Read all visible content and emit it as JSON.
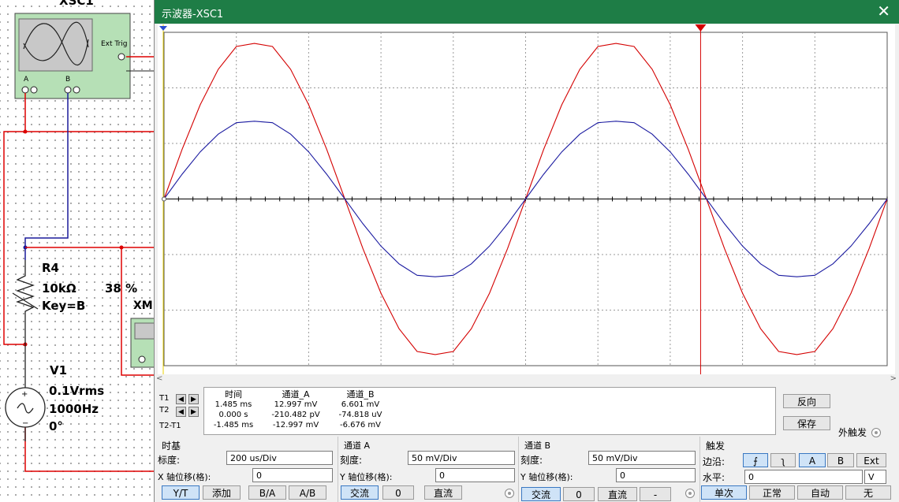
{
  "schematic": {
    "scope_ref": "XSC1",
    "ext_trig": "Ext Trig",
    "ch_a": "A",
    "ch_b": "B",
    "r_name": "R4",
    "r_value": "10kΩ",
    "r_percent": "38 %",
    "r_key": "Key=B",
    "xm_label": "XM",
    "v_name": "V1",
    "v_amp": "0.1Vrms",
    "v_freq": "1000Hz",
    "v_phase": "0°",
    "colors": {
      "wire_red": "#dd0000",
      "wire_blue": "#1a1a9a"
    }
  },
  "window": {
    "title": "示波器-XSC1",
    "close_label": "✕",
    "titlebar_color": "#1e7d46"
  },
  "chart_data": {
    "type": "line",
    "x_divisions": 10,
    "y_divisions": 6,
    "timebase": "200 us/Div",
    "cursor_t1_fraction": 0.742,
    "series": [
      {
        "channel": "A",
        "color": "#d40000",
        "scale": "50 mV/Div",
        "peak_mV": 13.0
      },
      {
        "channel": "B",
        "color": "#1a1aa0",
        "scale": "50 mV/Div",
        "peak_mV": 6.6
      }
    ],
    "frequency_hz": 1000,
    "x_range_us": [
      0,
      2000
    ]
  },
  "readout": {
    "headers": [
      "时间",
      "通道_A",
      "通道_B"
    ],
    "row_labels": [
      "T1",
      "T2",
      "T2-T1"
    ],
    "rows": [
      [
        "1.485 ms",
        "12.997 mV",
        "6.601 mV"
      ],
      [
        "0.000 s",
        "-210.482 pV",
        "-74.818 uV"
      ],
      [
        "-1.485 ms",
        "-12.997 mV",
        "-6.676 mV"
      ]
    ],
    "reverse_label": "反向",
    "save_label": "保存",
    "ext_trigger_label": "外触发"
  },
  "timebase": {
    "title": "时基",
    "scale_label": "标度:",
    "scale_value": "200 us/Div",
    "xpos_label": "X 轴位移(格):",
    "xpos_value": "0",
    "buttons": [
      "Y/T",
      "添加",
      "B/A",
      "A/B"
    ]
  },
  "channel_a": {
    "title": "通道 A",
    "scale_label": "刻度:",
    "scale_value": "50 mV/Div",
    "ypos_label": "Y 轴位移(格):",
    "ypos_value": "0",
    "buttons": [
      "交流",
      "0",
      "直流"
    ]
  },
  "channel_b": {
    "title": "通道 B",
    "scale_label": "刻度:",
    "scale_value": "50 mV/Div",
    "ypos_label": "Y 轴位移(格):",
    "ypos_value": "0",
    "buttons": [
      "交流",
      "0",
      "直流",
      "-"
    ]
  },
  "trigger": {
    "title": "触发",
    "edge_label": "边沿:",
    "edge_buttons": [
      "⨍",
      "ʅ",
      "A",
      "B",
      "Ext"
    ],
    "level_label": "水平:",
    "level_value": "0",
    "level_unit": "V",
    "mode_buttons": [
      "单次",
      "正常",
      "自动",
      "无"
    ]
  }
}
